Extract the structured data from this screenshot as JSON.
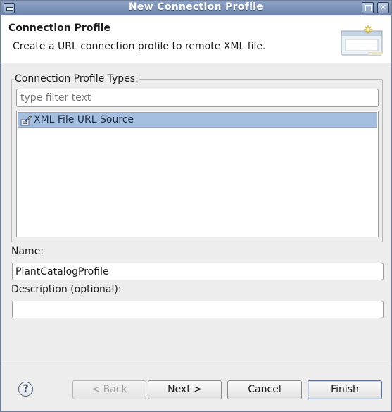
{
  "window": {
    "title": "New Connection Profile"
  },
  "header": {
    "heading": "Connection Profile",
    "description": "Create a URL connection profile to remote XML file.",
    "icon": "wizard-banner-icon"
  },
  "types": {
    "group_label": "Connection Profile Types:",
    "filter_placeholder": "type filter text",
    "filter_value": "",
    "items": [
      {
        "label": "XML File URL Source",
        "icon": "xml-url-source-icon",
        "selected": true
      }
    ]
  },
  "form": {
    "name_label": "Name:",
    "name_value": "PlantCatalogProfile",
    "description_label": "Description (optional):",
    "description_value": ""
  },
  "buttons": {
    "help": "?",
    "back": "< Back",
    "next": "Next >",
    "cancel": "Cancel",
    "finish": "Finish"
  },
  "colors": {
    "titlebar": "#7890b8",
    "selection": "#a5bfe1",
    "window_bg": "#ededed"
  }
}
